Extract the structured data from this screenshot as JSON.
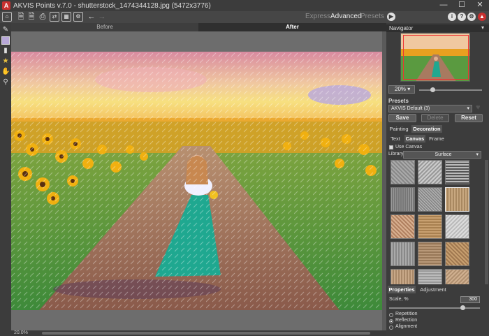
{
  "window": {
    "title": "AKVIS Points v.7.0 - shutterstock_1474344128.jpg (5472x3776)",
    "app_icon_glyph": "A",
    "controls": [
      "—",
      "☐",
      "✕"
    ]
  },
  "toolbar": {
    "icons": [
      "home-icon",
      "open-file-icon",
      "save-file-icon",
      "print-icon",
      "share-icon",
      "batch-icon",
      "plugin-icon",
      "undo-icon",
      "redo-icon"
    ],
    "modes": [
      "Express",
      "Advanced",
      "Presets"
    ],
    "active_mode": "Advanced",
    "run_icon": "play-icon",
    "right_icons": [
      "info-icon",
      "help-icon",
      "settings-icon",
      "cart-icon"
    ]
  },
  "tools": [
    "paint-brush-icon",
    "color-swatch",
    "eraser-icon",
    "stamp-icon",
    "hand-icon",
    "zoom-icon"
  ],
  "view_tabs": {
    "before": "Before",
    "after": "After"
  },
  "status": {
    "zoom": "20.0%"
  },
  "navigator": {
    "title": "Navigator",
    "zoom": "20%"
  },
  "presets": {
    "title": "Presets",
    "selected": "AKVIS Default (3)",
    "save": "Save",
    "delete": "Delete",
    "reset": "Reset"
  },
  "settings_tabs": {
    "painting": "Painting",
    "decoration": "Decoration"
  },
  "decoration_tabs": {
    "text": "Text",
    "canvas": "Canvas",
    "frame": "Frame"
  },
  "canvas": {
    "use_canvas": "Use Canvas",
    "library_label": "Library",
    "library_value": "Surface"
  },
  "property_tabs": {
    "properties": "Properties",
    "adjustment": "Adjustment"
  },
  "properties": {
    "scale_label": "Scale, %",
    "scale_value": "300",
    "options": [
      "Repetition",
      "Reflection",
      "Alignment"
    ],
    "selected_option": "Reflection"
  }
}
